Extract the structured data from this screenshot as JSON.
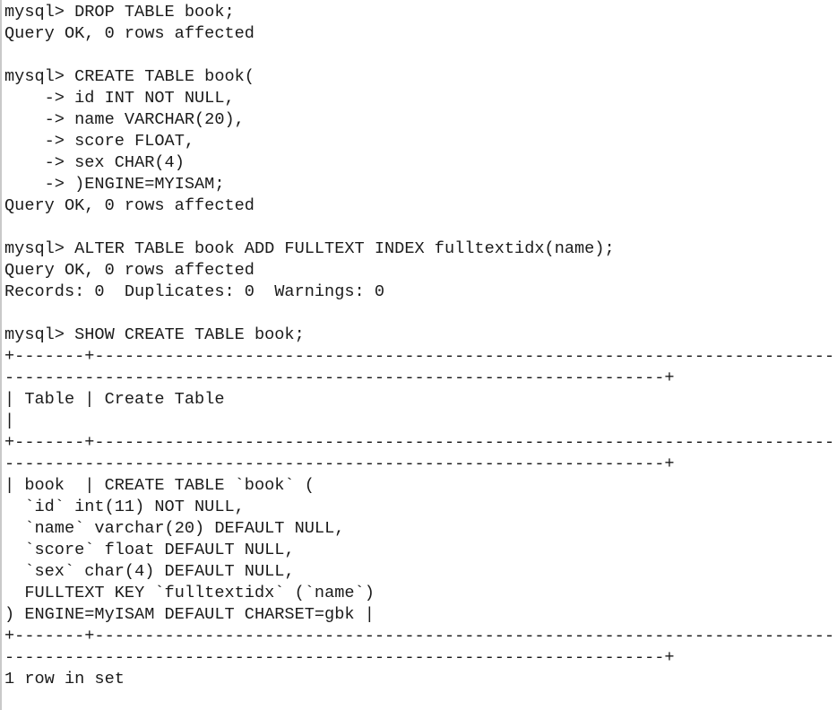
{
  "terminal": {
    "app": "mysql-client-console",
    "background_color": "#ffffff",
    "text_color": "#1a1a1a",
    "border_color": "#c9c9c9",
    "prompt": "mysql>",
    "continuation_prompt": "->",
    "lines": [
      "mysql> DROP TABLE book;",
      "Query OK, 0 rows affected",
      "",
      "mysql> CREATE TABLE book(",
      "    -> id INT NOT NULL,",
      "    -> name VARCHAR(20),",
      "    -> score FLOAT,",
      "    -> sex CHAR(4)",
      "    -> )ENGINE=MYISAM;",
      "Query OK, 0 rows affected",
      "",
      "mysql> ALTER TABLE book ADD FULLTEXT INDEX fulltextidx(name);",
      "Query OK, 0 rows affected",
      "Records: 0  Duplicates: 0  Warnings: 0",
      "",
      "mysql> SHOW CREATE TABLE book;",
      "+-------+--------------------------------------------------------------------------------------------------------------------------------------------+",
      "| Table | Create Table                                                                                                                                |",
      "+-------+--------------------------------------------------------------------------------------------------------------------------------------------+",
      "| book  | CREATE TABLE `book` (",
      "  `id` int(11) NOT NULL,",
      "  `name` varchar(20) DEFAULT NULL,",
      "  `score` float DEFAULT NULL,",
      "  `sex` char(4) DEFAULT NULL,",
      "  FULLTEXT KEY `fulltextidx` (`name`)",
      ") ENGINE=MyISAM DEFAULT CHARSET=gbk |",
      "+-------+--------------------------------------------------------------------------------------------------------------------------------------------+",
      "1 row in set"
    ],
    "statements": [
      {
        "command": "DROP TABLE book;",
        "result": "Query OK, 0 rows affected"
      },
      {
        "command": "CREATE TABLE book( id INT NOT NULL, name VARCHAR(20), score FLOAT, sex CHAR(4) )ENGINE=MYISAM;",
        "result": "Query OK, 0 rows affected"
      },
      {
        "command": "ALTER TABLE book ADD FULLTEXT INDEX fulltextidx(name);",
        "result": "Query OK, 0 rows affected",
        "info": "Records: 0  Duplicates: 0  Warnings: 0"
      },
      {
        "command": "SHOW CREATE TABLE book;",
        "result": "1 row in set"
      }
    ],
    "result_table": {
      "columns": [
        "Table",
        "Create Table"
      ],
      "rows": [
        {
          "Table": "book",
          "Create Table": "CREATE TABLE `book` (\n  `id` int(11) NOT NULL,\n  `name` varchar(20) DEFAULT NULL,\n  `score` float DEFAULT NULL,\n  `sex` char(4) DEFAULT NULL,\n  FULLTEXT KEY `fulltextidx` (`name`)\n) ENGINE=MyISAM DEFAULT CHARSET=gbk"
        }
      ],
      "row_count_label": "1 row in set"
    }
  }
}
